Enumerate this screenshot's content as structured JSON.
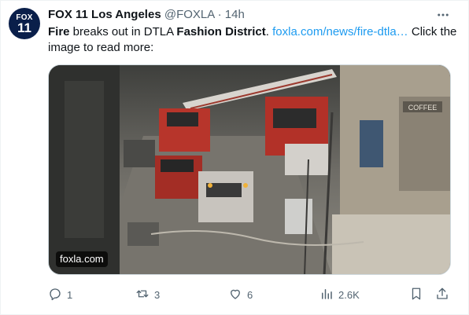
{
  "account": {
    "avatar_line1": "FOX",
    "avatar_line2": "11",
    "display_name": "FOX 11 Los Angeles",
    "handle": "@FOXLA",
    "separator": "·",
    "time": "14h"
  },
  "tweet": {
    "part1": "Fire",
    "part2": " breaks out in DTLA ",
    "part3": "Fashion District",
    "part4": ". ",
    "link": "foxla.com/news/fire-dtla…",
    "part5": " Click the image to read more:"
  },
  "media": {
    "caption": "foxla.com",
    "sign_coffee": "COFFEE"
  },
  "actions": {
    "replies": "1",
    "reposts": "3",
    "likes": "6",
    "views": "2.6K"
  },
  "icons": [
    "more-icon",
    "reply-icon",
    "repost-icon",
    "like-icon",
    "views-icon",
    "bookmark-icon",
    "share-icon"
  ],
  "colors": {
    "link": "#1d9bf0",
    "muted": "#536471",
    "text": "#0f1419"
  }
}
